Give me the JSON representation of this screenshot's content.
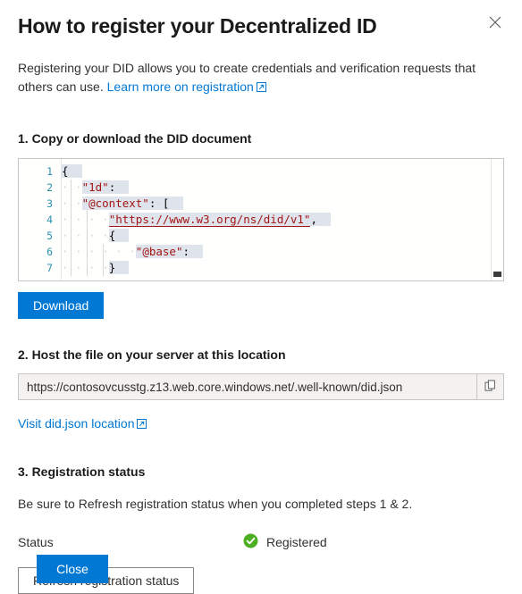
{
  "panel": {
    "title": "How to register your Decentralized ID",
    "close_icon": "close-icon"
  },
  "intro": {
    "text": "Registering your DID allows you to create credentials and verification requests that others can use.",
    "link_label": "Learn more on registration",
    "external_icon": "external-link-icon"
  },
  "step1": {
    "heading": "1. Copy or download the DID document",
    "download_label": "Download",
    "editor": {
      "line_numbers": [
        "1",
        "2",
        "3",
        "4",
        "5",
        "6",
        "7"
      ],
      "lines": [
        {
          "n": "1",
          "text": "{"
        },
        {
          "n": "2",
          "text": "  \"1d\":"
        },
        {
          "n": "3",
          "text": "  \"@context\": ["
        },
        {
          "n": "4",
          "text": "    \"https://www.w3.org/ns/did/v1\","
        },
        {
          "n": "5",
          "text": "    {"
        },
        {
          "n": "6",
          "text": "      \"@base\":"
        },
        {
          "n": "7",
          "text": "    }"
        }
      ],
      "url_token": "\"https://www.w3.org/ns/did/v1\"",
      "key_id": "\"1d\"",
      "key_context": "\"@context\"",
      "key_base": "\"@base\""
    }
  },
  "step2": {
    "heading": "2. Host the file on your server at this location",
    "url_value": "https://contosovcusstg.z13.web.core.windows.net/.well-known/did.json",
    "copy_icon": "copy-icon",
    "visit_link_label": "Visit did.json location",
    "external_icon": "external-link-icon"
  },
  "step3": {
    "heading": "3. Registration status",
    "description": "Be sure to Refresh registration status when you completed steps 1 & 2.",
    "status_label": "Status",
    "status_value": "Registered",
    "status_icon": "check-circle-icon",
    "refresh_label": "Refresh registration status"
  },
  "footer": {
    "close_label": "Close"
  },
  "colors": {
    "accent": "#0078d4",
    "success": "#4caf21",
    "code_key": "#a31515",
    "line_number": "#2b91af",
    "selection": "#dfe4ec"
  }
}
